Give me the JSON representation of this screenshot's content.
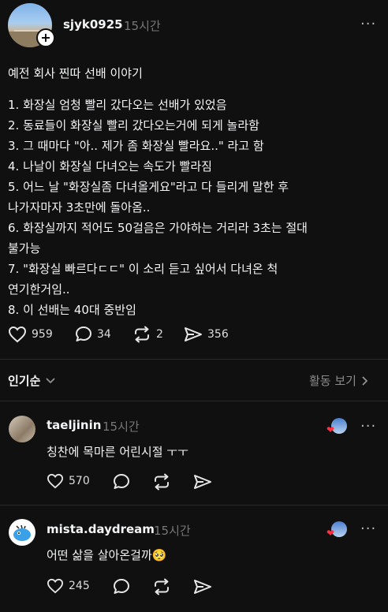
{
  "post": {
    "username": "sjyk0925",
    "time": "15시간",
    "more_label": "···",
    "lines": [
      "예전 회사 찐따 선배 이야기",
      "",
      "1. 화장실 엄청 빨리 갔다오는 선배가 있었음",
      "2. 동료들이 화장실 빨리 갔다오는거에 되게 놀라함",
      "3. 그 때마다 \"아.. 제가 좀 화장실 빨라요..\" 라고 함",
      "4. 나날이 화장실 다녀오는 속도가 빨라짐",
      "5. 어느 날 \"화장실좀 다녀올게요\"라고 다 들리게 말한 후",
      "나가자마자 3초만에 돌아옴..",
      "6. 화장실까지 적어도 50걸음은 가야하는 거리라 3초는 절대",
      "불가능",
      "7. \"화장실 빠르다ㄷㄷ\" 이 소리 듣고 싶어서 다녀온 척",
      "연기한거임..",
      "8. 이 선배는 40대 중반임"
    ],
    "likes": "959",
    "comments": "34",
    "reposts": "2",
    "shares": "356"
  },
  "sort": {
    "label": "인기순",
    "activity_label": "활동 보기"
  },
  "comments": [
    {
      "username": "taeljinin",
      "time": "15시간",
      "text": "칭찬에 목마른 어린시절 ㅜㅜ",
      "likes": "570"
    },
    {
      "username": "mista.daydream",
      "time": "15시간",
      "text": "어떤 삶을 살아온걸까🥺",
      "likes": "245"
    }
  ]
}
